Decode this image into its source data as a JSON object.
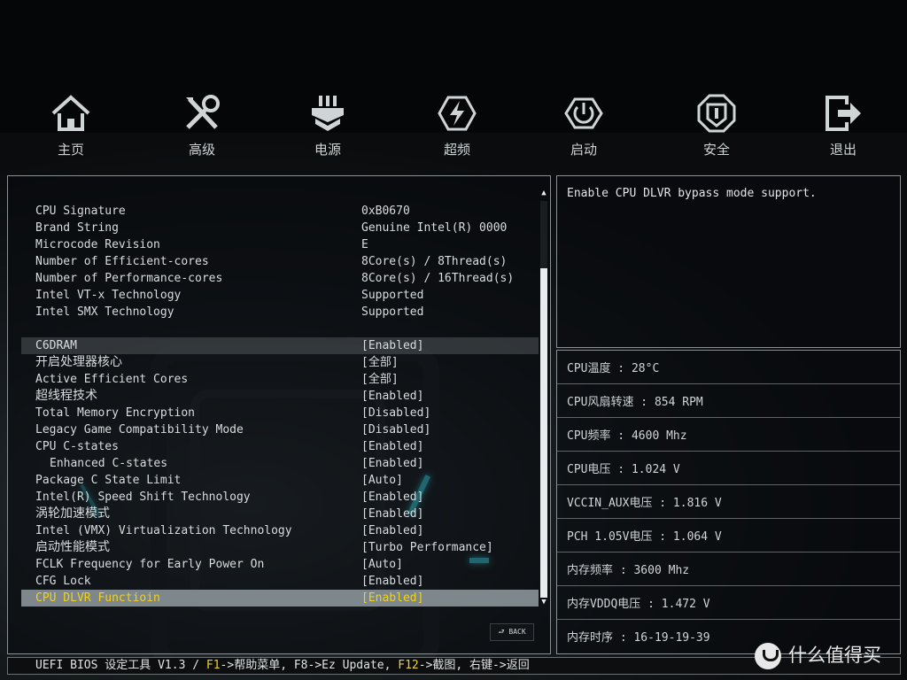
{
  "nav": [
    {
      "label": "主页",
      "icon": "home-icon"
    },
    {
      "label": "高级",
      "icon": "tools-icon"
    },
    {
      "label": "电源",
      "icon": "power-plug-icon"
    },
    {
      "label": "超频",
      "icon": "lightning-icon"
    },
    {
      "label": "启动",
      "icon": "power-icon"
    },
    {
      "label": "安全",
      "icon": "shield-icon"
    },
    {
      "label": "退出",
      "icon": "exit-icon"
    }
  ],
  "info_rows": [
    {
      "label": "CPU Signature",
      "value": "0xB0670"
    },
    {
      "label": "Brand String",
      "value": "Genuine Intel(R) 0000"
    },
    {
      "label": "Microcode Revision",
      "value": "E"
    },
    {
      "label": "Number of Efficient-cores",
      "value": "8Core(s) / 8Thread(s)"
    },
    {
      "label": "Number of Performance-cores",
      "value": "8Core(s) / 16Thread(s)"
    },
    {
      "label": "Intel VT-x Technology",
      "value": "Supported"
    },
    {
      "label": "Intel SMX Technology",
      "value": "Supported"
    }
  ],
  "settings": [
    {
      "label": "C6DRAM",
      "value": "[Enabled]"
    },
    {
      "label": "开启处理器核心",
      "value": "[全部]"
    },
    {
      "label": "Active Efficient Cores",
      "value": "[全部]"
    },
    {
      "label": "超线程技术",
      "value": "[Enabled]"
    },
    {
      "label": "Total Memory Encryption",
      "value": "[Disabled]"
    },
    {
      "label": "Legacy Game Compatibility Mode",
      "value": "[Disabled]"
    },
    {
      "label": "CPU C-states",
      "value": "[Enabled]"
    },
    {
      "label": "Enhanced C-states",
      "value": "[Enabled]"
    },
    {
      "label": "Package C State Limit",
      "value": "[Auto]"
    },
    {
      "label": "Intel(R) Speed Shift Technology",
      "value": "[Enabled]"
    },
    {
      "label": "涡轮加速模式",
      "value": "[Enabled]"
    },
    {
      "label": "Intel (VMX) Virtualization Technology",
      "value": "[Enabled]"
    },
    {
      "label": "启动性能模式",
      "value": "[Turbo Performance]"
    },
    {
      "label": "FCLK Frequency for Early Power On",
      "value": "[Auto]"
    },
    {
      "label": "CFG Lock",
      "value": "[Enabled]"
    },
    {
      "label": "CPU DLVR Functioin",
      "value": "[Enabled]"
    }
  ],
  "back_label": "BACK",
  "help_text": "Enable CPU DLVR bypass mode support.",
  "stats": [
    "CPU温度 : 28°C",
    "CPU风扇转速 : 854 RPM",
    "CPU频率 : 4600 Mhz",
    "CPU电压 : 1.024 V",
    "VCCIN_AUX电压 : 1.816 V",
    "PCH 1.05V电压 : 1.064 V",
    "内存频率 : 3600 Mhz",
    "内存VDDQ电压 : 1.472 V",
    "内存时序 : 16-19-19-39"
  ],
  "footer": {
    "part1": "UEFI BIOS 设定工具 V1.3 / ",
    "f1": "F1",
    "part2": "->帮助菜单, F8->Ez Update, ",
    "f12": "F12",
    "part3": "->截图, 右键->返回"
  },
  "watermark": "什么值得买",
  "colors": {
    "highlight": "#f2d21a",
    "accent": "#3fd7e6",
    "selected_row": "#7d878c"
  }
}
